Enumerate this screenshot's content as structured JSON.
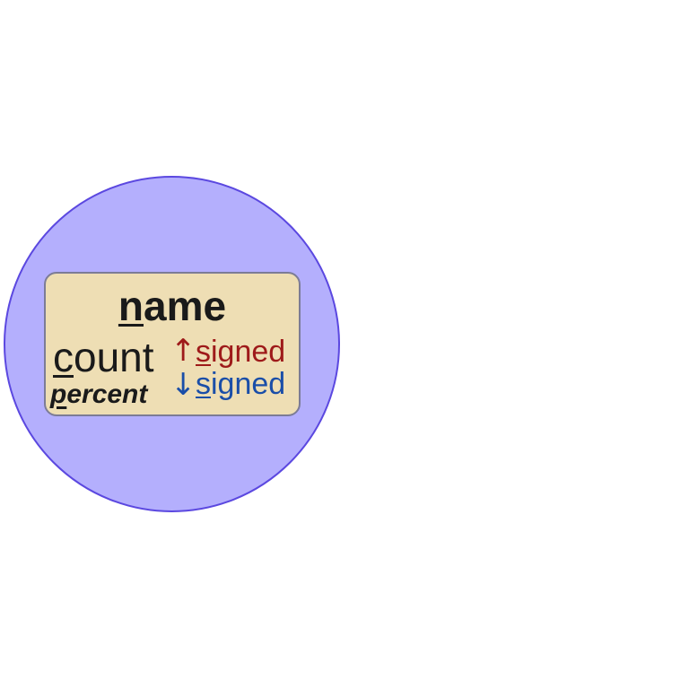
{
  "diagram": {
    "circle_fill": "#b4affd",
    "circle_stroke": "#5b48e0",
    "card_fill": "#eedeb4",
    "card_stroke": "#7c7c96",
    "name": {
      "first": "n",
      "rest": "ame",
      "color": "#1a1a1a"
    },
    "count": {
      "first": "c",
      "rest": "ount",
      "color": "#1a1a1a"
    },
    "percent": {
      "first": "p",
      "rest": "ercent",
      "color": "#1a1a1a"
    },
    "up_arrow": {
      "glyph": "↑",
      "color": "#9e1a1a"
    },
    "down_arrow": {
      "glyph": "↓",
      "color": "#1a4ea8"
    },
    "signed_up": {
      "first": "s",
      "rest": "igned",
      "color": "#9e1a1a"
    },
    "signed_down": {
      "first": "s",
      "rest": "igned",
      "color": "#1a4ea8"
    }
  }
}
